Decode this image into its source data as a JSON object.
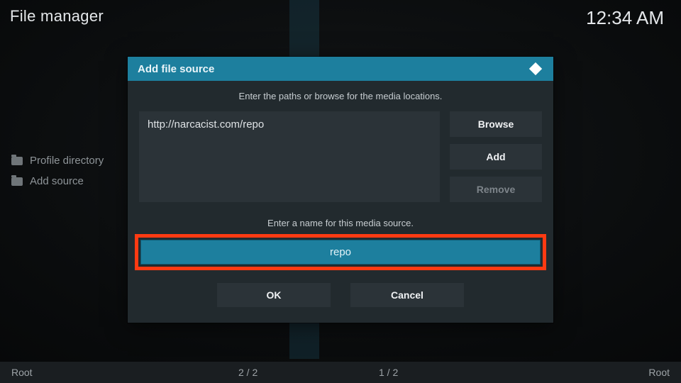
{
  "header": {
    "title": "File manager",
    "clock": "12:34 AM"
  },
  "sidebar": {
    "items": [
      {
        "label": "Profile directory"
      },
      {
        "label": "Add source"
      }
    ]
  },
  "dialog": {
    "title": "Add file source",
    "paths_hint": "Enter the paths or browse for the media locations.",
    "path_value": "http://narcacist.com/repo",
    "browse_label": "Browse",
    "add_label": "Add",
    "remove_label": "Remove",
    "name_hint": "Enter a name for this media source.",
    "name_value": "repo",
    "ok_label": "OK",
    "cancel_label": "Cancel"
  },
  "footer": {
    "left_root": "Root",
    "count_a": "2 / 2",
    "count_b": "1 / 2",
    "right_root": "Root"
  }
}
